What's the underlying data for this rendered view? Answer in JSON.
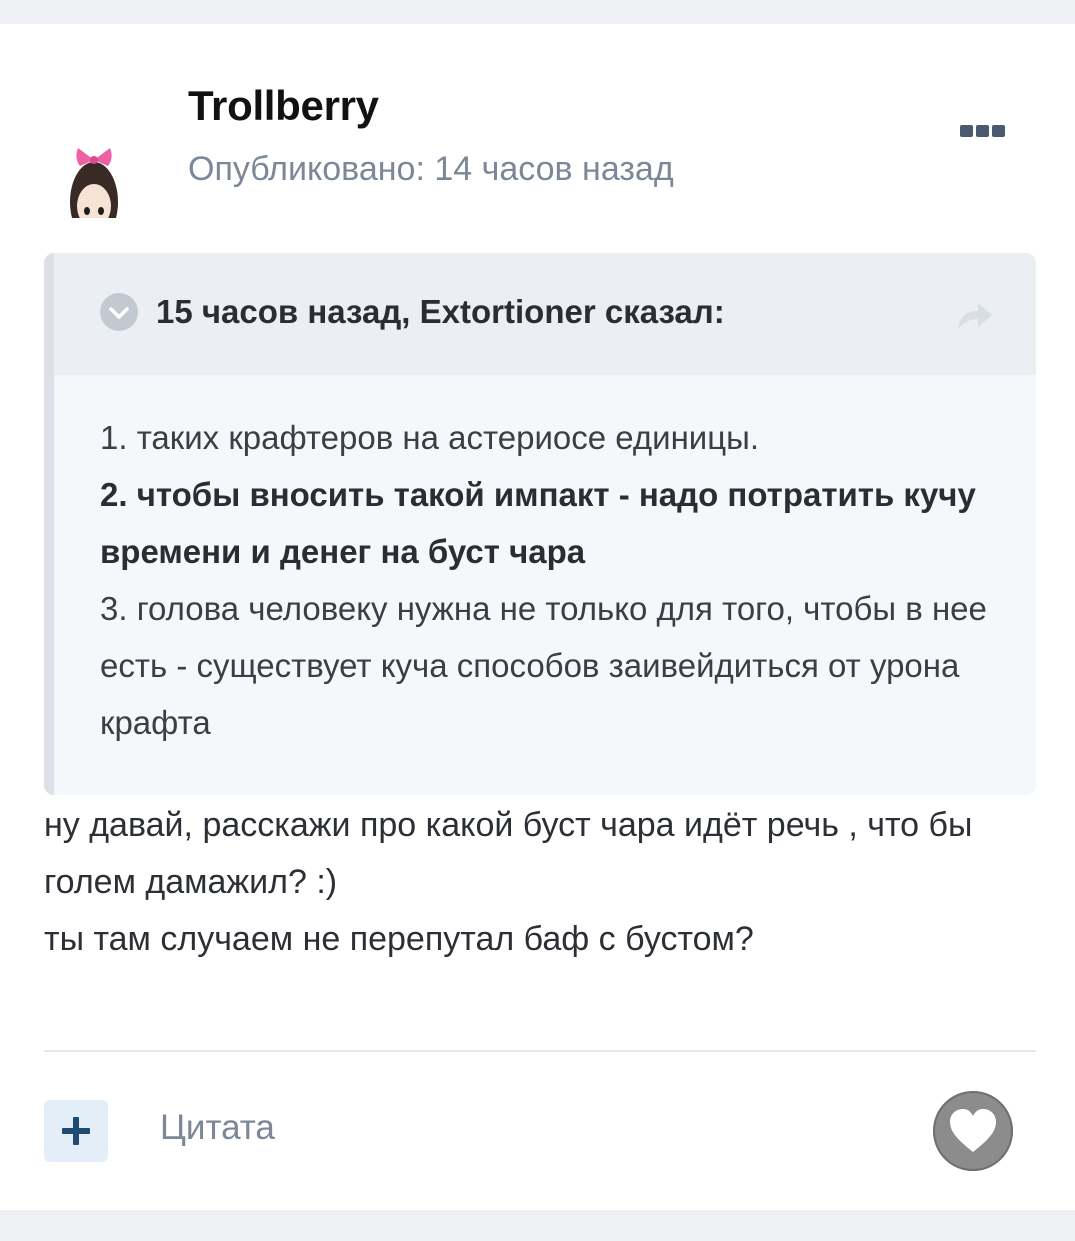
{
  "post": {
    "author": "Trollberry",
    "published": "Опубликовано: 14 часов назад",
    "more_icon": "more-dots-icon",
    "avatar_icon": "avatar"
  },
  "quote": {
    "citation": "15 часов назад, Extortioner сказал:",
    "collapse_icon": "chevron-down-icon",
    "share_icon": "share-icon",
    "lines": [
      {
        "text": "1. таких крафтеров на астериосе единицы.",
        "bold": false
      },
      {
        "text": "2. чтобы вносить такой импакт - надо потратить кучу времени и денег на буст чара",
        "bold": true
      },
      {
        "text": "3. голова человеку нужна не только для того, чтобы в нее есть - существует куча способов заивейдиться от урона крафта",
        "bold": false
      }
    ]
  },
  "reply": {
    "line1": "ну давай, расскажи про какой буст чара идёт речь , что бы голем дамажил? :)",
    "line2": "ты там случаем не перепутал баф с бустом?"
  },
  "footer": {
    "plus_icon": "plus-icon",
    "quote_label": "Цитата",
    "like_icon": "heart-icon"
  },
  "colors": {
    "accent": "#1f4a73",
    "muted_text": "#7c8797",
    "quote_bg": "#f5f8fb",
    "quote_head_bg": "#ebeef2"
  }
}
